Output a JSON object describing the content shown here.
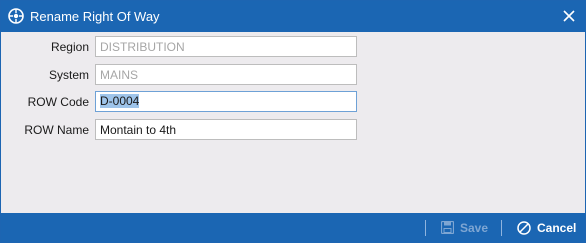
{
  "window": {
    "title": "Rename Right Of Way",
    "icon": "app-logo-icon",
    "close_icon": "close-icon"
  },
  "form": {
    "fields": [
      {
        "label": "Region",
        "value": "DISTRIBUTION",
        "state": "readonly"
      },
      {
        "label": "System",
        "value": "MAINS",
        "state": "readonly"
      },
      {
        "label": "ROW Code",
        "value": "D-0004",
        "state": "focused-selected"
      },
      {
        "label": "ROW Name",
        "value": "Montain to 4th",
        "state": "editable"
      }
    ]
  },
  "footer": {
    "save_label": "Save",
    "save_enabled": false,
    "cancel_label": "Cancel"
  },
  "colors": {
    "title_bar": "#1b66b3",
    "body": "#edebee",
    "selection": "#9ec4ea",
    "disabled_text": "#a6a6a6"
  }
}
